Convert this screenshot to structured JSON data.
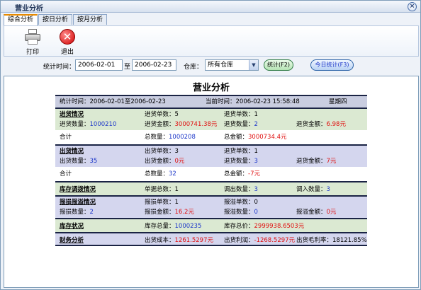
{
  "window": {
    "title": "营业分析",
    "close_glyph": "×"
  },
  "tabs": [
    {
      "label": "综合分析",
      "active": true
    },
    {
      "label": "按日分析",
      "active": false
    },
    {
      "label": "按月分析",
      "active": false
    }
  ],
  "toolbar": {
    "print_label": "打印",
    "exit_label": "退出",
    "exit_glyph": "✕"
  },
  "filter": {
    "period_label": "统计时间：",
    "date_from": "2006-02-01",
    "to_label": "至",
    "date_to": "2006-02-23",
    "warehouse_label": "仓库：",
    "warehouse_value": "所有仓库",
    "stat_button": "统计(F2)",
    "today_button": "今日统计(F3)"
  },
  "report": {
    "title": "营业分析",
    "period_label": "统计时间：2006-02-01至2006-02-23",
    "current_time_label": "当前时间：",
    "current_time_value": "2006-02-23 15:58:48",
    "weekday": "星期四",
    "purchase": {
      "heading": "进货情况",
      "order_count_label": "进货单数：",
      "order_count": "5",
      "return_order_label": "退货单数：",
      "return_order_count": "1",
      "qty_label": "进货数量：",
      "qty": "1000210",
      "amount_label": "进货金额：",
      "amount": "3000741.38元",
      "return_qty_label": "退货数量：",
      "return_qty": "2",
      "return_amount_label": "退货金额：",
      "return_amount": "6.98元",
      "total_label": "合计",
      "total_qty_label": "总数量：",
      "total_qty": "1000208",
      "total_amount_label": "总金额：",
      "total_amount": "3000734.4元"
    },
    "sales": {
      "heading": "出货情况",
      "order_count_label": "出货单数：",
      "order_count": "3",
      "return_order_label": "退货单数：",
      "return_order_count": "1",
      "qty_label": "出货数量：",
      "qty": "35",
      "amount_label": "出货金额：",
      "amount": "0元",
      "return_qty_label": "退货数量：",
      "return_qty": "3",
      "return_amount_label": "退货金额：",
      "return_amount": "7元",
      "total_label": "合计",
      "total_qty_label": "总数量：",
      "total_qty": "32",
      "total_amount_label": "总金额：",
      "total_amount": "-7元"
    },
    "transfer": {
      "heading": "库存调拨情况",
      "doc_total_label": "单据总数：",
      "doc_total": "1",
      "out_qty_label": "调出数量：",
      "out_qty": "3",
      "in_qty_label": "调入数量：",
      "in_qty": "3"
    },
    "loss": {
      "heading": "报损报溢情况",
      "loss_orders_label": "报损单数：",
      "loss_orders": "1",
      "gain_orders_label": "报溢单数：",
      "gain_orders": "0",
      "loss_qty_label": "报损数量：",
      "loss_qty": "2",
      "loss_amount_label": "报损金额：",
      "loss_amount": "16.2元",
      "gain_qty_label": "报溢数量：",
      "gain_qty": "0",
      "gain_amount_label": "报溢金额：",
      "gain_amount": "0元"
    },
    "stock": {
      "heading": "库存状况",
      "total_qty_label": "库存总量：",
      "total_qty": "1000235",
      "total_value_label": "库存总价：",
      "total_value": "2999938.6503元"
    },
    "finance": {
      "heading": "财务分析",
      "cost_label": "出货成本：",
      "cost": "1261.5297元",
      "profit_label": "出货利润：",
      "profit": "-1268.5297元",
      "margin_label": "出货毛利率：",
      "margin": "18121.85%"
    }
  }
}
